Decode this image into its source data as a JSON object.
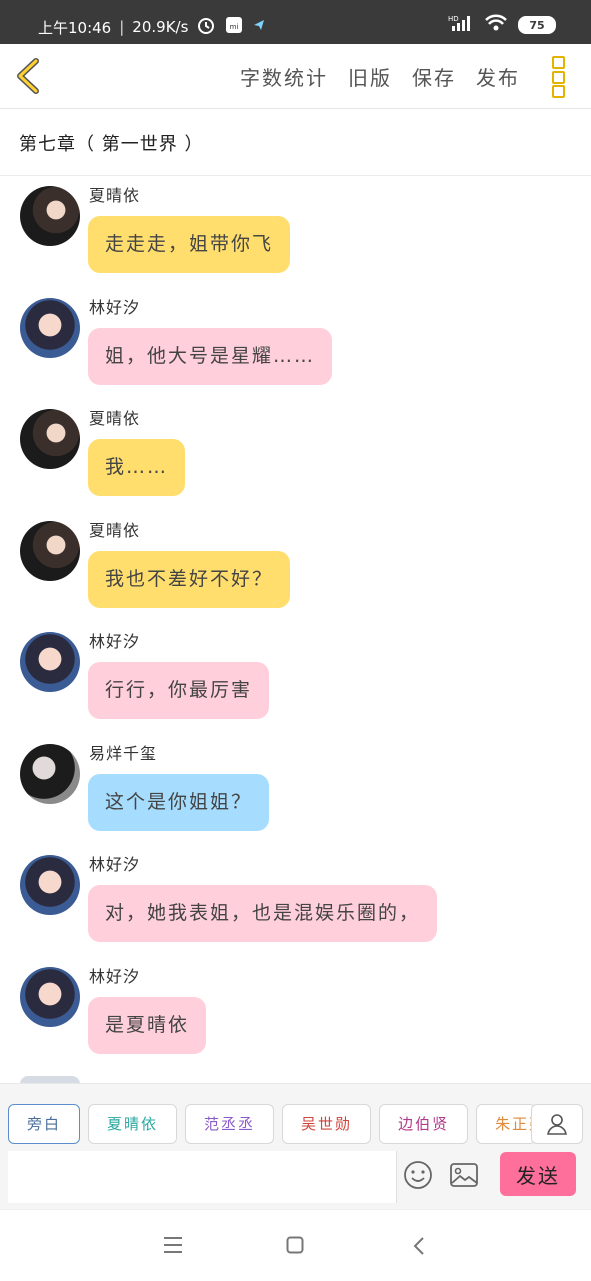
{
  "status_bar": {
    "time": "上午10:46",
    "speed": "20.9K/s",
    "battery": "75",
    "net_label": "HD"
  },
  "toolbar": {
    "actions": [
      "字数统计",
      "旧版",
      "保存",
      "发布"
    ]
  },
  "chapter": {
    "title": "第七章（ 第一世界 ）"
  },
  "messages": [
    {
      "sender": "夏晴依",
      "text": "走走走，姐带你飞",
      "color": "yellow",
      "avatar": "xia"
    },
    {
      "sender": "林好汐",
      "text": "姐，他大号是星耀……",
      "color": "pink",
      "avatar": "lin"
    },
    {
      "sender": "夏晴依",
      "text": "我……",
      "color": "yellow",
      "avatar": "xia"
    },
    {
      "sender": "夏晴依",
      "text": "我也不差好不好？",
      "color": "yellow",
      "avatar": "xia"
    },
    {
      "sender": "林好汐",
      "text": "行行，你最厉害",
      "color": "pink",
      "avatar": "lin"
    },
    {
      "sender": "易烊千玺",
      "text": "这个是你姐姐？",
      "color": "blue",
      "avatar": "yi"
    },
    {
      "sender": "林好汐",
      "text": "对，她我表姐，也是混娱乐圈的，",
      "color": "pink",
      "avatar": "lin"
    },
    {
      "sender": "林好汐",
      "text": "是夏晴依",
      "color": "pink",
      "avatar": "lin"
    }
  ],
  "compose": {
    "roles": [
      {
        "label": "旁白",
        "color": "#4a6f9c"
      },
      {
        "label": "夏晴依",
        "color": "#2aa7a0"
      },
      {
        "label": "范丞丞",
        "color": "#8a5cc9"
      },
      {
        "label": "吴世勋",
        "color": "#d0453b"
      },
      {
        "label": "边伯贤",
        "color": "#b03a8c"
      },
      {
        "label": "朱正廷",
        "color": "#e08a3a"
      }
    ],
    "input_placeholder": "",
    "send_label": "发送"
  }
}
